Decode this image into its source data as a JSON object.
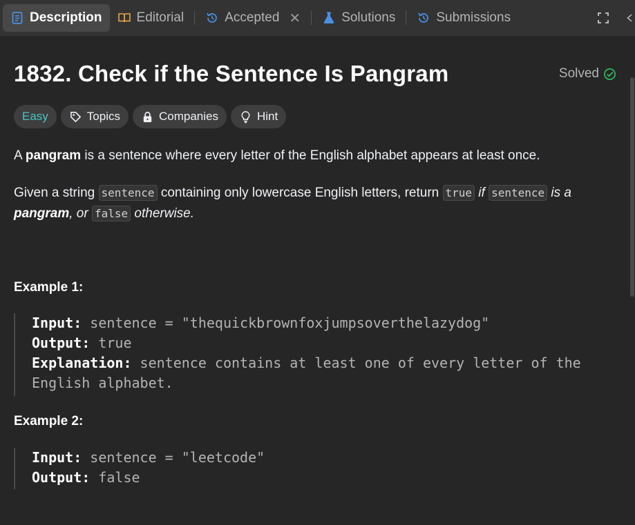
{
  "tabs": [
    {
      "label": "Description"
    },
    {
      "label": "Editorial"
    },
    {
      "label": "Accepted"
    },
    {
      "label": "Solutions"
    },
    {
      "label": "Submissions"
    }
  ],
  "tab_close_glyph": "✕",
  "problem": {
    "title": "1832. Check if the Sentence Is Pangram",
    "status": "Solved"
  },
  "tags": [
    {
      "label": "Easy"
    },
    {
      "label": "Topics"
    },
    {
      "label": "Companies"
    },
    {
      "label": "Hint"
    }
  ],
  "description": {
    "p1": {
      "prefix": "A ",
      "bold": "pangram",
      "suffix": " is a sentence where every letter of the English alphabet appears at least once."
    },
    "p2": {
      "t1": "Given a string ",
      "c1": "sentence",
      "t2": " containing only lowercase English letters, return ",
      "c2": "true",
      "t3": " if ",
      "c3": "sentence",
      "t4": " is a ",
      "b1": "pangram",
      "t5": ", or ",
      "c4": "false",
      "t6": " otherwise."
    }
  },
  "examples": [
    {
      "title": "Example 1:",
      "input_label": "Input:",
      "input": "sentence = \"thequickbrownfoxjumpsoverthelazydog\"",
      "output_label": "Output:",
      "output": "true",
      "explanation_label": "Explanation:",
      "explanation": "sentence contains at least one of every letter of the English alphabet."
    },
    {
      "title": "Example 2:",
      "input_label": "Input:",
      "input": "sentence = \"leetcode\"",
      "output_label": "Output:",
      "output": "false"
    }
  ],
  "colors": {
    "background": "#262626",
    "tabbar": "#333333",
    "active_tab": "#484848",
    "easy": "#46c6c2",
    "solved_check": "#2cbb5d",
    "accent_blue": "#4a90e2"
  },
  "icons": {
    "description": "description-icon",
    "editorial": "book-icon",
    "accepted": "history-icon",
    "solutions": "flask-icon",
    "submissions": "history-icon",
    "topics": "tag-icon",
    "companies": "lock-icon",
    "hint": "lightbulb-icon",
    "solved": "check-circle-icon",
    "expand": "expand-icon",
    "collapse": "chevron-left-icon"
  }
}
